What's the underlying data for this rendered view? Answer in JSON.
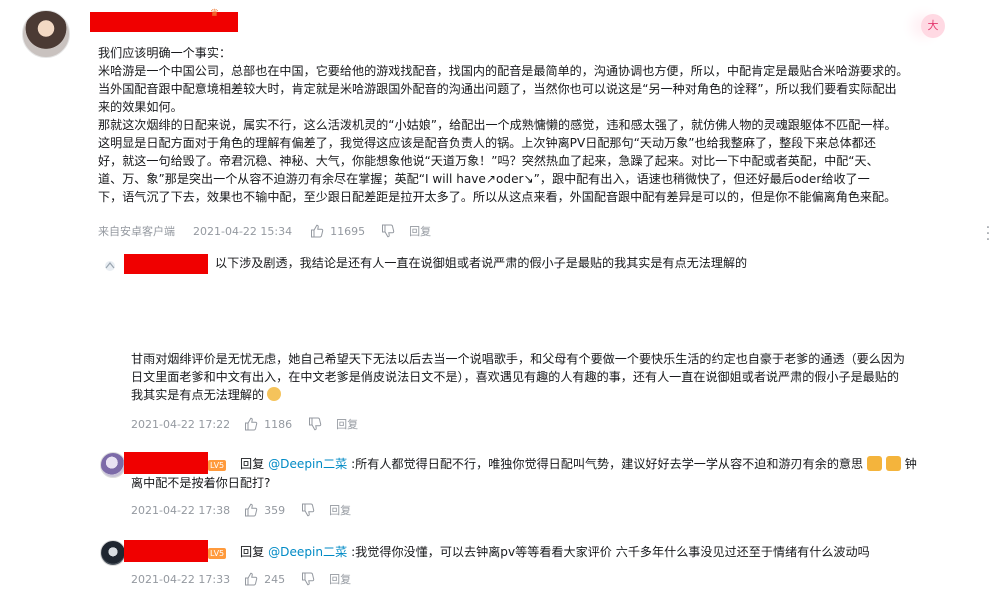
{
  "main_comment": {
    "badge": "大",
    "text_lines": [
      "我们应该明确一个事实：",
      "米哈游是一个中国公司，总部也在中国，它要给他的游戏找配音，找国内的配音是最简单的，沟通协调也方便，所以，中配肯定是最贴合米哈游要求的。",
      "当外国配音跟中配意境相差较大时，肯定就是米哈游跟国外配音的沟通出问题了，当然你也可以说这是“另一种对角色的诠释”，所以我们要看实际配出",
      "来的效果如何。",
      "那就这次烟绯的日配来说，属实不行，这么活泼机灵的“小姑娘”，给配出一个成熟慵懒的感觉，违和感太强了，就仿佛人物的灵魂跟躯体不匹配一样。",
      "这明显是日配方面对于角色的理解有偏差了，我觉得这应该是配音负责人的锅。上次钟离PV日配那句“天动万象”也给我整麻了，整段下来总体都还",
      "好，就这一句给毁了。帝君沉稳、神秘、大气，你能想象他说“天道万象！”吗？突然热血了起来，急躁了起来。对比一下中配或者英配，中配“天、",
      "道、万、象”那是突出一个从容不迫游刃有余尽在掌握；英配“I will have↗oder↘”，跟中配有出入，语速也稍微快了，但还好最后oder给收了一",
      "下，语气沉了下去，效果也不输中配，至少跟日配差距是拉开太多了。所以从这点来看，外国配音跟中配有差异是可以的，但是你不能偏离角色来配。"
    ],
    "source": "来自安卓客户端",
    "time": "2021-04-22 15:34",
    "likes": "11695",
    "reply_label": "回复"
  },
  "replies": [
    {
      "intro": "以下涉及剧透，我结论是还有人一直在说御姐或者说严肃的假小子是最贴的我其实是有点无法理解的",
      "text_lines": [
        "甘雨对烟绯评价是无忧无虑，她自己希望天下无法以后去当一个说唱歌手，和父母有个要做一个要快乐生活的约定也自豪于老爹的通透（要么因为",
        "日文里面老爹和中文有出入，在中文老爹是俏皮说法日文不是），喜欢遇见有趣的人有趣的事，还有人一直在说御姐或者说严肃的假小子是最贴的",
        "我其实是有点无法理解的"
      ],
      "time": "2021-04-22 17:22",
      "likes": "1186",
      "reply_label": "回复"
    },
    {
      "level": "LV5",
      "prefix": "回复",
      "at": "@Deepin二菜",
      "text_line1": ":所有人都觉得日配不行，唯独你觉得日配叫气势，建议好好去学一学从容不迫和游刃有余的意思",
      "text_line1_tail": "钟",
      "text_line2": "离中配不是按着你日配打?",
      "time": "2021-04-22 17:38",
      "likes": "359",
      "reply_label": "回复"
    },
    {
      "level": "LV5",
      "prefix": "回复",
      "at": "@Deepin二菜",
      "text": ":我觉得你没懂，可以去钟离pv等等看看大家评价 六千多年什么事没见过还至于情绪有什么波动吗",
      "time": "2021-04-22 17:33",
      "likes": "245",
      "reply_label": "回复"
    }
  ],
  "colors": {
    "redact": "#f00000",
    "meta": "#9499a0",
    "link": "#008ac5"
  }
}
